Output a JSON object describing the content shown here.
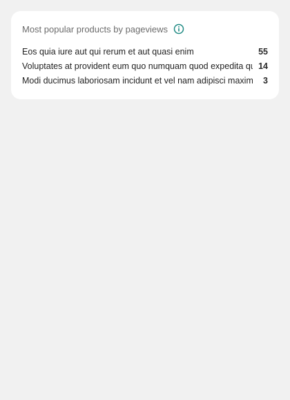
{
  "widget": {
    "title": "Most popular products by pageviews",
    "info_icon": "info-circle-icon",
    "accent_color": "#1f8a83"
  },
  "products": [
    {
      "name": "Eos quia iure aut qui rerum et aut quasi enim",
      "pageviews": "55"
    },
    {
      "name": "Voluptates at provident eum quo numquam quod expedita qui",
      "pageviews": "14"
    },
    {
      "name": "Modi ducimus laboriosam incidunt et vel nam adipisci maxime",
      "pageviews": "3"
    }
  ]
}
